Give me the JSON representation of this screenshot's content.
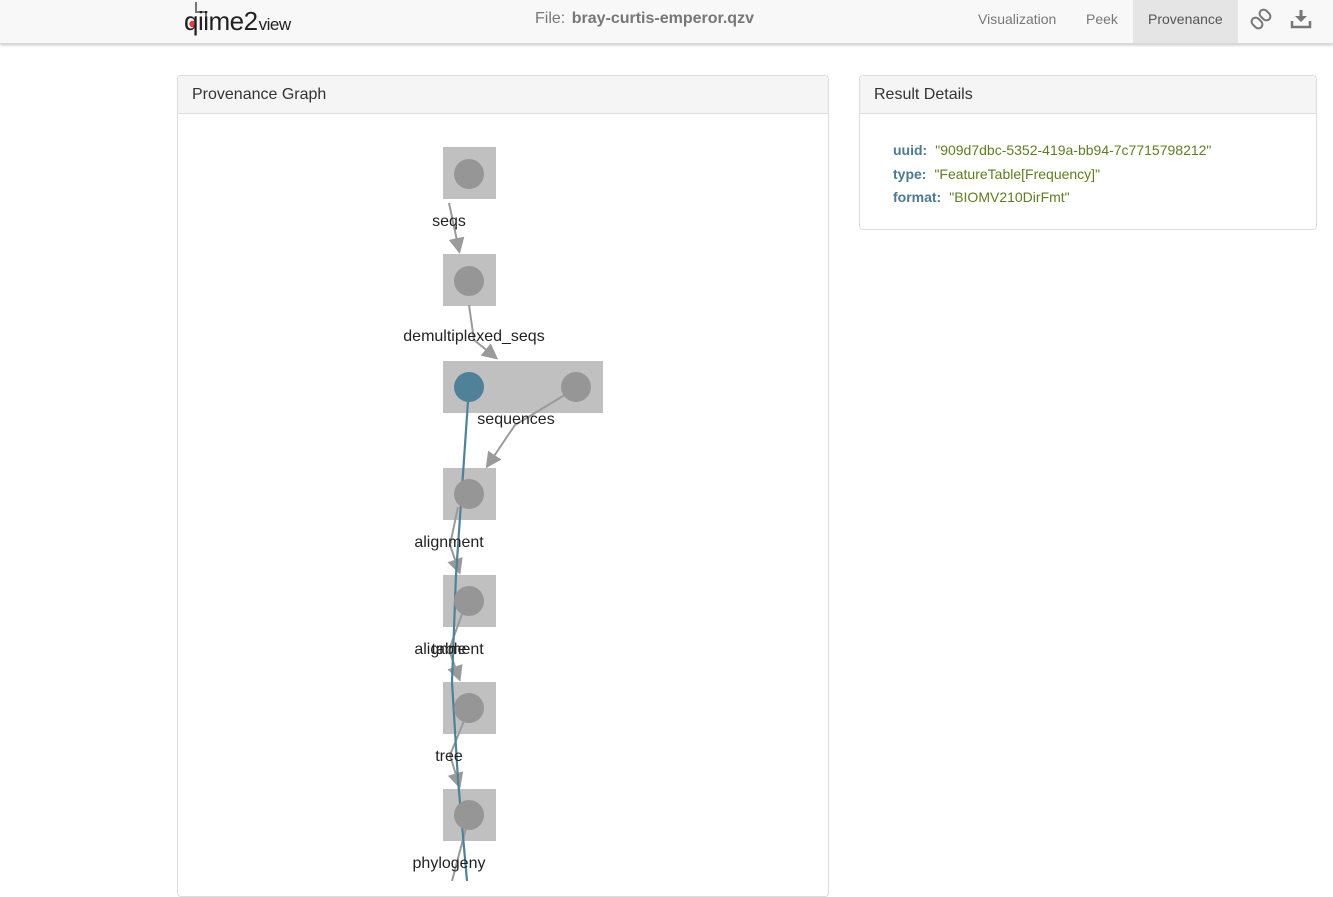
{
  "app": {
    "logo_main": "qiime2",
    "logo_sub": "view"
  },
  "header": {
    "file_prefix": "File:",
    "file_name": "bray-curtis-emperor.qzv"
  },
  "nav": {
    "visualization": "Visualization",
    "peek": "Peek",
    "provenance": "Provenance",
    "active": "Provenance",
    "link_icon": "link-icon",
    "download_icon": "download-icon"
  },
  "graph_panel": {
    "title": "Provenance Graph",
    "nodes": [
      {
        "label": "seqs"
      },
      {
        "label": "demultiplexed_seqs"
      },
      {
        "label": "sequences"
      },
      {
        "label": "alignment"
      },
      {
        "label": "alignment"
      },
      {
        "label": "table"
      },
      {
        "label": "tree"
      },
      {
        "label": "phylogeny"
      }
    ],
    "colors": {
      "node_box": "#c0c0c0",
      "node_circle": "#969696",
      "highlight_circle": "#4f8298",
      "edge": "#9a9a9a",
      "highlight_edge": "#4f8298"
    }
  },
  "details_panel": {
    "title": "Result Details",
    "uuid_key": "uuid:",
    "uuid_value": "\"909d7dbc-5352-419a-bb94-7c7715798212\"",
    "type_key": "type:",
    "type_value": "\"FeatureTable[Frequency]\"",
    "format_key": "format:",
    "format_value": "\"BIOMV210DirFmt\""
  }
}
